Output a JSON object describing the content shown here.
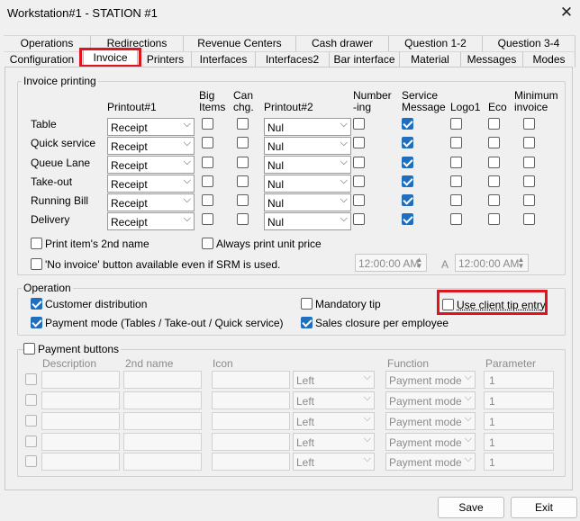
{
  "window": {
    "title": "Workstation#1 - STATION #1",
    "close_glyph": "✕"
  },
  "tabs_row1": [
    "Operations",
    "Redirections",
    "Revenue Centers",
    "Cash drawer",
    "Question 1-2",
    "Question 3-4"
  ],
  "tabs_row2": [
    "Configuration",
    "Invoice",
    "Printers",
    "Interfaces",
    "Interfaces2",
    "Bar interface",
    "Material",
    "Messages",
    "Modes"
  ],
  "invoice_printing": {
    "title": "Invoice printing",
    "headers": {
      "printout1": "Printout#1",
      "big_items": "Big\nItems",
      "can_chg": "Can\nchg.",
      "printout2": "Printout#2",
      "numbering": "Number\n-ing",
      "service_message": "Service\nMessage",
      "logo1": "Logo1",
      "eco": "Eco",
      "minimum_invoice": "Minimum\ninvoice"
    },
    "rows": [
      {
        "label": "Table",
        "printout1": "Receipt",
        "printout2": "Nul",
        "service_message": true
      },
      {
        "label": "Quick service",
        "printout1": "Receipt",
        "printout2": "Nul",
        "service_message": true
      },
      {
        "label": "Queue Lane",
        "printout1": "Receipt",
        "printout2": "Nul",
        "service_message": true
      },
      {
        "label": "Take-out",
        "printout1": "Receipt",
        "printout2": "Nul",
        "service_message": true
      },
      {
        "label": "Running Bill",
        "printout1": "Receipt",
        "printout2": "Nul",
        "service_message": true
      },
      {
        "label": "Delivery",
        "printout1": "Receipt",
        "printout2": "Nul",
        "service_message": true
      }
    ],
    "print_2nd_name": "Print item's 2nd name",
    "always_unit_price": "Always print unit price",
    "no_invoice_button": "'No invoice' button available even if SRM is used.",
    "time_from": "12:00:00 AM",
    "time_sep": "A",
    "time_to": "12:00:00 AM"
  },
  "operation": {
    "title": "Operation",
    "customer_distribution": "Customer distribution",
    "mandatory_tip": "Mandatory tip",
    "use_client_tip_entry": "Use client tip entry",
    "payment_mode": "Payment mode (Tables / Take-out / Quick service)",
    "sales_closure": "Sales closure per employee"
  },
  "payment_buttons": {
    "title": "Payment buttons",
    "headers": [
      "Description",
      "2nd name",
      "Icon",
      "Function",
      "Parameter"
    ],
    "rows": [
      {
        "align": "Left",
        "function": "Payment mode",
        "parameter": "1"
      },
      {
        "align": "Left",
        "function": "Payment mode",
        "parameter": "1"
      },
      {
        "align": "Left",
        "function": "Payment mode",
        "parameter": "1"
      },
      {
        "align": "Left",
        "function": "Payment mode",
        "parameter": "1"
      },
      {
        "align": "Left",
        "function": "Payment mode",
        "parameter": "1"
      }
    ]
  },
  "buttons": {
    "save": "Save",
    "exit": "Exit"
  },
  "icons": {
    "dropdown": "chevron-down-icon",
    "spinner": "spinner-arrows-icon",
    "close": "close-icon"
  },
  "colors": {
    "highlight": "#e0141e",
    "checkbox_checked": "#1f6fbf"
  }
}
